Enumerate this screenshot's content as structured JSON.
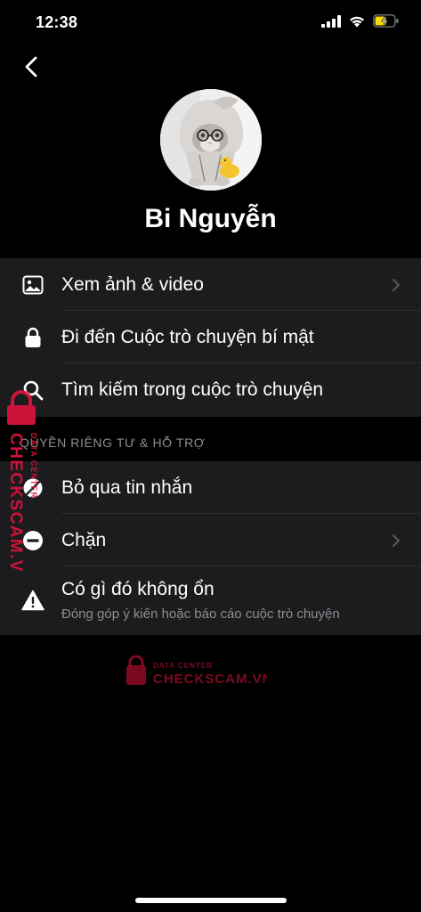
{
  "status_bar": {
    "time": "12:38"
  },
  "profile": {
    "name": "Bi Nguyễn"
  },
  "menu_group_1": [
    {
      "label": "Xem ảnh & video",
      "icon": "photo-icon",
      "chevron": true
    },
    {
      "label": "Đi đến Cuộc trò chuyện bí mật",
      "icon": "lock-icon",
      "chevron": false
    },
    {
      "label": "Tìm kiếm trong cuộc trò chuyện",
      "icon": "search-icon",
      "chevron": false
    }
  ],
  "privacy_section": {
    "header": "QUYỀN RIÊNG TƯ & HỖ TRỢ",
    "items": [
      {
        "label": "Bỏ qua tin nhắn",
        "icon": "ignore-message-icon",
        "chevron": false
      },
      {
        "label": "Chặn",
        "icon": "block-icon",
        "chevron": true
      },
      {
        "label": "Có gì đó không ổn",
        "sublabel": "Đóng góp ý kiến hoặc báo cáo cuộc trò chuyện",
        "icon": "warning-icon",
        "chevron": false
      }
    ]
  },
  "watermark": {
    "small": "DATA CENTER",
    "big": "CHECKSCAM.VN"
  },
  "colors": {
    "background": "#000000",
    "group_background": "#1c1c1e",
    "secondary_text": "#8e8e93",
    "watermark": "#e0133d",
    "battery": "#f5d90a"
  }
}
